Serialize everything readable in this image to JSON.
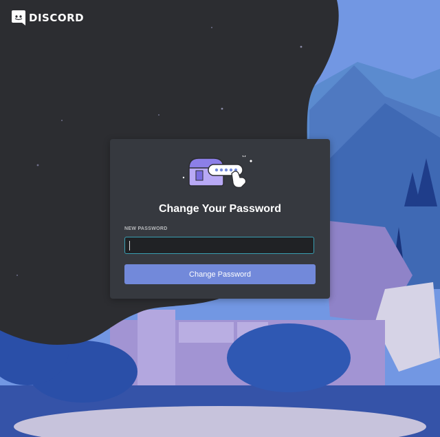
{
  "brand": {
    "name": "DISCORD"
  },
  "dialog": {
    "title": "Change Your Password",
    "field_label": "NEW PASSWORD",
    "input_value": "",
    "button_label": "Change Password"
  },
  "colors": {
    "card_bg": "#36393f",
    "button": "#7289da",
    "input_border": "#3a9fb3",
    "page_bg_dark": "#2f3136"
  }
}
